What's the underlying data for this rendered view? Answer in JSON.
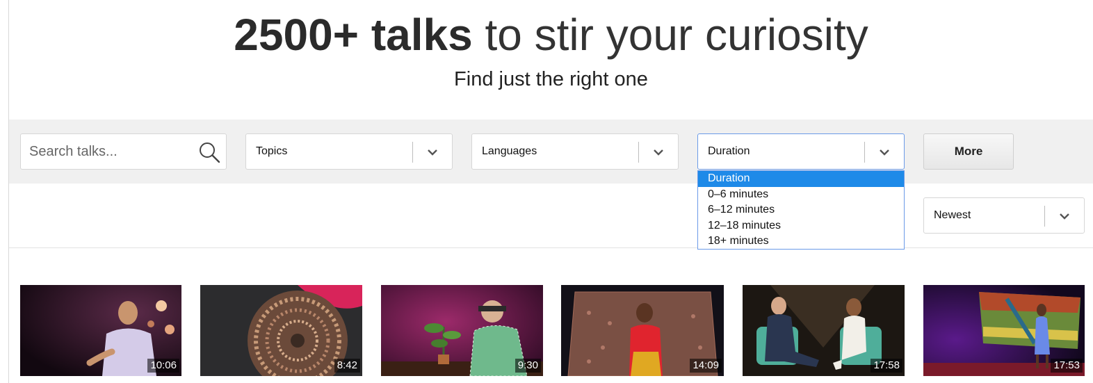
{
  "hero": {
    "title_bold": "2500+ talks",
    "title_rest": " to stir your curiosity",
    "subtitle": "Find just the right one"
  },
  "filters": {
    "search_placeholder": "Search talks...",
    "topics": "Topics",
    "languages": "Languages",
    "duration": "Duration",
    "more": "More"
  },
  "duration_dropdown": {
    "options": [
      "Duration",
      "0–6 minutes",
      "6–12 minutes",
      "12–18 minutes",
      "18+ minutes"
    ],
    "selected": "Duration"
  },
  "sort": {
    "value": "Newest"
  },
  "talks": [
    {
      "duration": "10:06"
    },
    {
      "duration": "8:42"
    },
    {
      "duration": "9:30"
    },
    {
      "duration": "14:09"
    },
    {
      "duration": "17:58"
    },
    {
      "duration": "17:53"
    }
  ],
  "colors": {
    "filter_bar": "#f0f0f0",
    "dropdown_highlight": "#1e8ae8",
    "focus_border": "#6a9ae8"
  }
}
